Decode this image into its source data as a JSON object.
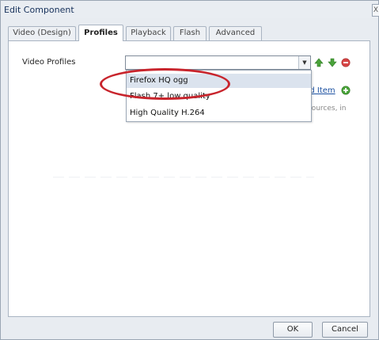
{
  "window": {
    "title": "Edit Component",
    "close_glyph": "X"
  },
  "tabs": [
    {
      "label": "Video (Design)",
      "active": false
    },
    {
      "label": "Profiles",
      "active": true
    },
    {
      "label": "Playback",
      "active": false
    },
    {
      "label": "Flash",
      "active": false
    },
    {
      "label": "Advanced",
      "active": false
    }
  ],
  "profiles": {
    "label": "Video Profiles",
    "select_value": "",
    "dropdown_options": [
      {
        "label": "Firefox HQ ogg",
        "highlighted": true
      },
      {
        "label": "Flash 7+ low quality",
        "highlighted": false
      },
      {
        "label": "High Quality H.264",
        "highlighted": false
      }
    ],
    "add_item_label": "dd Item",
    "helper_text": "sources, in"
  },
  "footer": {
    "ok_label": "OK",
    "cancel_label": "Cancel"
  },
  "icons": {
    "move_up": "arrow-up-icon",
    "move_down": "arrow-down-icon",
    "remove": "remove-icon",
    "add": "add-icon"
  },
  "colors": {
    "annotation": "#c8242c",
    "link": "#1a4fa0",
    "icon_green": "#4aa33a",
    "icon_red": "#d64545"
  }
}
